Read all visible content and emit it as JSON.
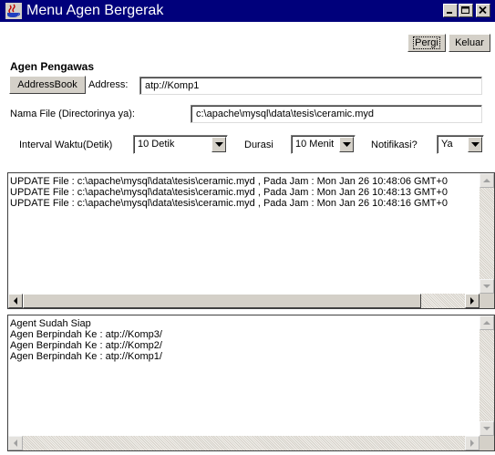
{
  "window": {
    "title": "Menu Agen Bergerak",
    "title_bar_color": "#00007b",
    "icon": "java-cup-icon"
  },
  "toolbar": {
    "pergi_label": "Pergi",
    "keluar_label": "Keluar"
  },
  "agent_section": {
    "heading": "Agen Pengawas",
    "addressbook_label": "AddressBook",
    "address_label": "Address:",
    "address_value": "atp://Komp1",
    "filename_label": "Nama File (Directorinya ya):",
    "filename_value": "c:\\apache\\mysql\\data\\tesis\\ceramic.myd"
  },
  "options": {
    "interval_label": "Interval Waktu(Detik)",
    "interval_value": "10 Detik",
    "durasi_label": "Durasi",
    "durasi_value": "10 Menit",
    "notifikasi_label": "Notifikasi?",
    "notifikasi_value": "Ya"
  },
  "update_log": [
    "UPDATE File : c:\\apache\\mysql\\data\\tesis\\ceramic.myd , Pada Jam : Mon Jan 26 10:48:06 GMT+0",
    "UPDATE File : c:\\apache\\mysql\\data\\tesis\\ceramic.myd , Pada Jam : Mon Jan 26 10:48:13 GMT+0",
    "UPDATE File : c:\\apache\\mysql\\data\\tesis\\ceramic.myd , Pada Jam : Mon Jan 26 10:48:16 GMT+0"
  ],
  "status_log": [
    "Agent Sudah Siap",
    "Agen Berpindah Ke : atp://Komp3/",
    "Agen Berpindah Ke : atp://Komp2/",
    "Agen Berpindah Ke : atp://Komp1/"
  ],
  "icons": {
    "minimize": "minimize-icon",
    "maximize": "maximize-icon",
    "close": "close-icon",
    "dropdown": "chevron-down-icon",
    "scroll_up": "arrow-up-icon",
    "scroll_down": "arrow-down-icon",
    "scroll_left": "arrow-left-icon",
    "scroll_right": "arrow-right-icon"
  }
}
